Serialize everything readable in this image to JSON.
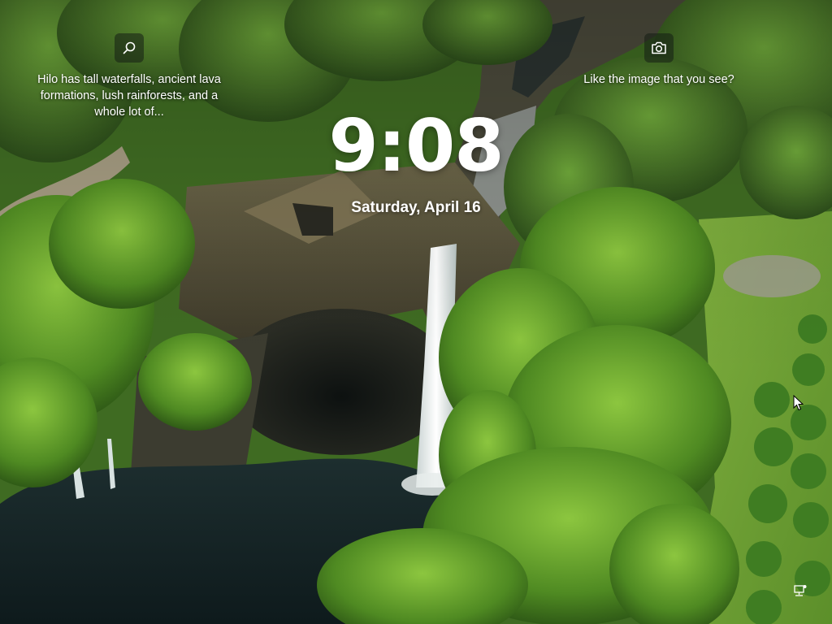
{
  "spotlight": {
    "info_icon": "search-icon",
    "info_text": "Hilo has tall waterfalls, ancient lava formations, lush rainforests, and a whole lot of...",
    "like_icon": "camera-icon",
    "like_text": "Like the image that you see?"
  },
  "clock": {
    "time": "9:08",
    "date": "Saturday, April 16"
  },
  "status": {
    "network_icon": "network-icon"
  },
  "colors": {
    "text": "#ffffff",
    "button_bg": "rgba(20, 30, 20, 0.55)",
    "foliage": "#5f9b2c",
    "water": "#1c2c2c"
  }
}
